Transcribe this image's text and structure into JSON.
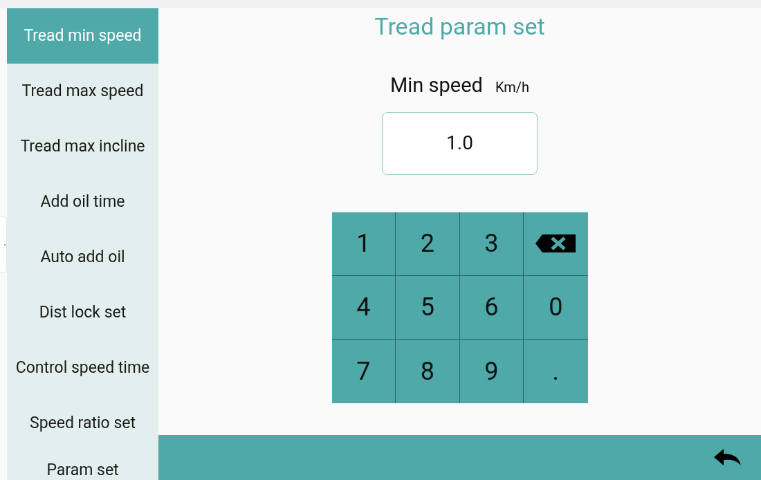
{
  "sidebar": {
    "items": [
      {
        "label": "Tread min speed",
        "selected": true
      },
      {
        "label": "Tread max speed",
        "selected": false
      },
      {
        "label": "Tread max incline",
        "selected": false
      },
      {
        "label": "Add oil time",
        "selected": false
      },
      {
        "label": "Auto add oil",
        "selected": false
      },
      {
        "label": "Dist lock set",
        "selected": false
      },
      {
        "label": "Control speed time",
        "selected": false
      },
      {
        "label": "Speed ratio set",
        "selected": false
      },
      {
        "label": "Param set",
        "selected": false
      }
    ]
  },
  "title": "Tread param set",
  "field": {
    "label": "Min speed",
    "unit": "Km/h",
    "value": "1.0"
  },
  "keypad": [
    {
      "kind": "digit",
      "label": "1"
    },
    {
      "kind": "digit",
      "label": "2"
    },
    {
      "kind": "digit",
      "label": "3"
    },
    {
      "kind": "backspace"
    },
    {
      "kind": "digit",
      "label": "4"
    },
    {
      "kind": "digit",
      "label": "5"
    },
    {
      "kind": "digit",
      "label": "6"
    },
    {
      "kind": "digit",
      "label": "0"
    },
    {
      "kind": "digit",
      "label": "7"
    },
    {
      "kind": "digit",
      "label": "8"
    },
    {
      "kind": "digit",
      "label": "9"
    },
    {
      "kind": "digit",
      "label": "."
    }
  ]
}
